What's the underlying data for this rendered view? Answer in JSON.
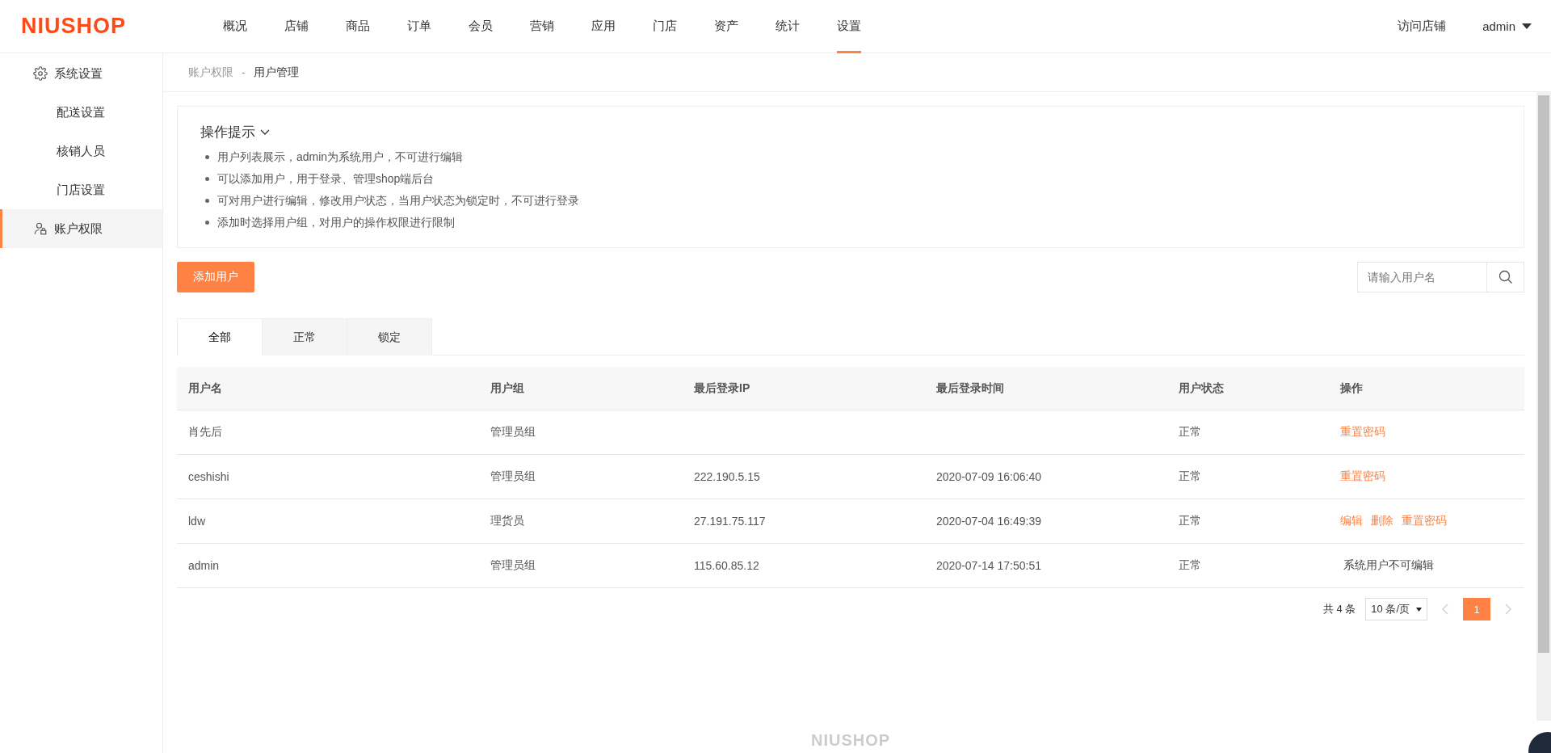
{
  "header": {
    "logo": "NIUSHOP",
    "nav": [
      {
        "label": "概况",
        "selected": false
      },
      {
        "label": "店铺",
        "selected": false
      },
      {
        "label": "商品",
        "selected": false
      },
      {
        "label": "订单",
        "selected": false
      },
      {
        "label": "会员",
        "selected": false
      },
      {
        "label": "营销",
        "selected": false
      },
      {
        "label": "应用",
        "selected": false
      },
      {
        "label": "门店",
        "selected": false
      },
      {
        "label": "资产",
        "selected": false
      },
      {
        "label": "统计",
        "selected": false
      },
      {
        "label": "设置",
        "selected": true
      }
    ],
    "visit_store": "访问店铺",
    "user": "admin"
  },
  "sidebar": {
    "items": [
      {
        "label": "系统设置",
        "kind": "settings",
        "selected": false
      },
      {
        "label": "配送设置",
        "kind": "item",
        "selected": false
      },
      {
        "label": "核销人员",
        "kind": "item",
        "selected": false
      },
      {
        "label": "门店设置",
        "kind": "item",
        "selected": false
      },
      {
        "label": "账户权限",
        "kind": "account",
        "selected": true
      }
    ]
  },
  "breadcrumb": {
    "parent": "账户权限",
    "separator": "-",
    "current": "用户管理"
  },
  "tips": {
    "title": "操作提示",
    "expanded": true,
    "items": [
      "用户列表展示，admin为系统用户，不可进行编辑",
      "可以添加用户，用于登录、管理shop端后台",
      "可对用户进行编辑，修改用户状态，当用户状态为锁定时，不可进行登录",
      "添加时选择用户组，对用户的操作权限进行限制"
    ]
  },
  "add_button": "添加用户",
  "search": {
    "placeholder": "请输入用户名"
  },
  "tabs": [
    {
      "label": "全部",
      "selected": true
    },
    {
      "label": "正常",
      "selected": false
    },
    {
      "label": "锁定",
      "selected": false
    }
  ],
  "table": {
    "columns": [
      "用户名",
      "用户组",
      "最后登录IP",
      "最后登录时间",
      "用户状态",
      "操作"
    ],
    "rows": [
      {
        "name": "肖先后",
        "group": "管理员组",
        "ip": "",
        "time": "",
        "status": "正常",
        "actions": [
          "重置密码"
        ]
      },
      {
        "name": "ceshishi",
        "group": "管理员组",
        "ip": "222.190.5.15",
        "time": "2020-07-09 16:06:40",
        "status": "正常",
        "actions": [
          "重置密码"
        ]
      },
      {
        "name": "ldw",
        "group": "理货员",
        "ip": "27.191.75.117",
        "time": "2020-07-04 16:49:39",
        "status": "正常",
        "actions": [
          "编辑",
          "删除",
          "重置密码"
        ]
      },
      {
        "name": "admin",
        "group": "管理员组",
        "ip": "115.60.85.12",
        "time": "2020-07-14 17:50:51",
        "status": "正常",
        "note": "系统用户不可编辑"
      }
    ]
  },
  "pagination": {
    "total": "共 4 条",
    "page_size": "10 条/页",
    "pages": [
      {
        "label": "1",
        "selected": true
      }
    ]
  },
  "footer": {
    "logo": "NIUSHOP"
  }
}
